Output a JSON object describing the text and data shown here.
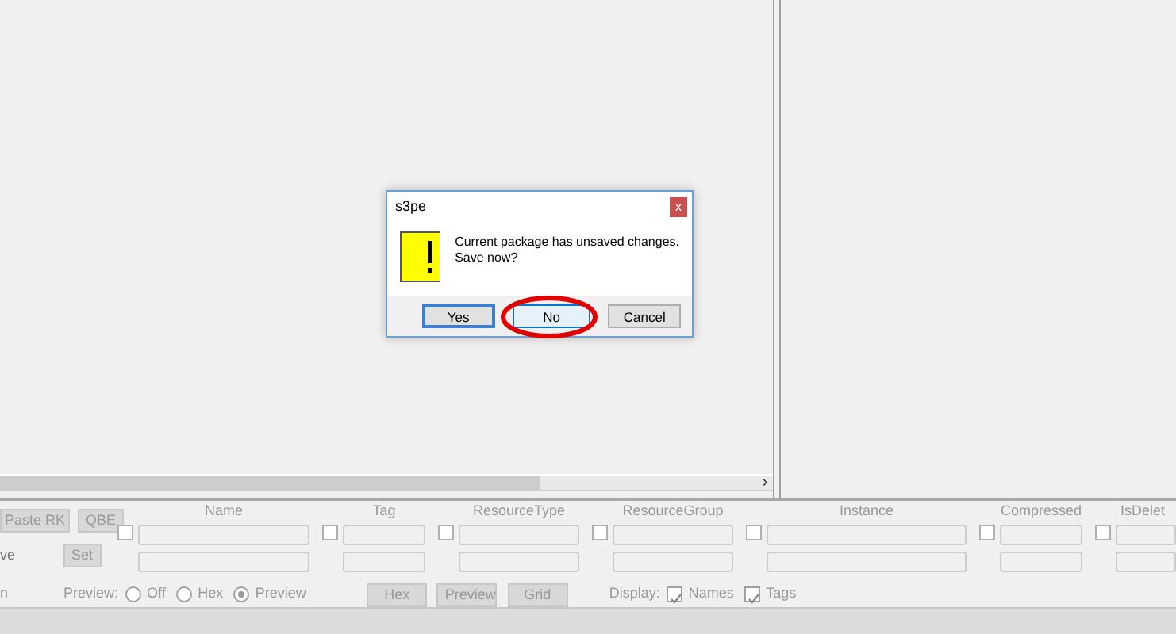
{
  "dialog": {
    "title": "s3pe",
    "close": "x",
    "message": "Current package has unsaved changes.\nSave now?",
    "buttons": [
      {
        "label": "Yes",
        "kind": "default"
      },
      {
        "label": "No",
        "kind": "hover"
      },
      {
        "label": "Cancel",
        "kind": "normal"
      }
    ]
  },
  "scrollbar": {
    "arrow": "›"
  },
  "actions": [
    {
      "label": "Paste RK",
      "disabled": true
    },
    {
      "label": "QBE",
      "disabled": true
    },
    {
      "label": "Set",
      "disabled": true
    }
  ],
  "partial_labels": [
    "ve",
    "n"
  ],
  "filters": [
    {
      "label": "Name",
      "checked": false
    },
    {
      "label": "Tag",
      "checked": false
    },
    {
      "label": "ResourceType",
      "checked": false
    },
    {
      "label": "ResourceGroup",
      "checked": false
    },
    {
      "label": "Instance",
      "checked": false
    },
    {
      "label": "Compressed",
      "checked": false
    },
    {
      "label": "IsDelet",
      "checked": false
    }
  ],
  "preview": {
    "label": "Preview:",
    "options": [
      {
        "label": "Off",
        "selected": false
      },
      {
        "label": "Hex",
        "selected": false
      },
      {
        "label": "Preview",
        "selected": true
      }
    ]
  },
  "view_buttons": [
    {
      "label": "Hex",
      "disabled": true
    },
    {
      "label": "Preview",
      "disabled": true
    },
    {
      "label": "Grid",
      "disabled": true
    }
  ],
  "display": {
    "label": "Display:",
    "options": [
      {
        "label": "Names",
        "checked": true
      },
      {
        "label": "Tags",
        "checked": true
      }
    ]
  }
}
